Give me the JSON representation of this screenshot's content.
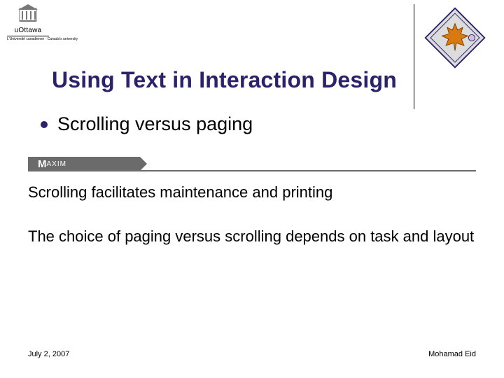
{
  "logo_uo": {
    "name": "uOttawa",
    "subtitle": "L'Université canadienne · Canada's university"
  },
  "title": "Using Text in Interaction Design",
  "bullet": "Scrolling versus paging",
  "maxim_prefix": "M",
  "maxim_rest": "AXIM",
  "para1": "Scrolling facilitates maintenance and printing",
  "para2": "The choice of paging versus scrolling depends on task and layout",
  "footer": {
    "date": "July 2, 2007",
    "author": "Mohamad Eid"
  }
}
